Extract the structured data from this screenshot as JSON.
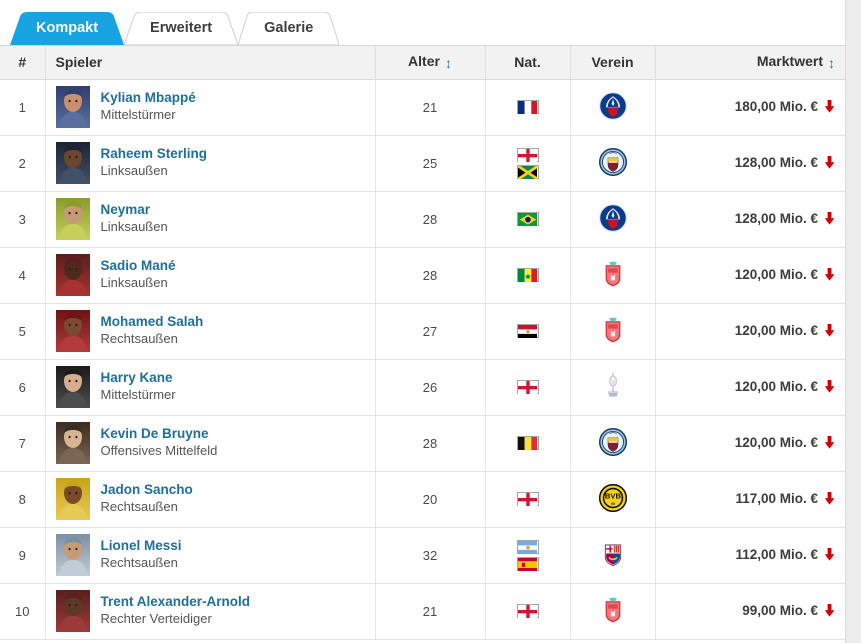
{
  "tabs": [
    {
      "label": "Kompakt",
      "active": true
    },
    {
      "label": "Erweitert",
      "active": false
    },
    {
      "label": "Galerie",
      "active": false
    }
  ],
  "colors": {
    "active_tab_bg": "#17a3e0",
    "link": "#1f6f9a",
    "header_bg": "#f2f2f2",
    "down_arrow": "#cc0000"
  },
  "table": {
    "columns": [
      {
        "key": "rank",
        "label": "#",
        "sortable": false
      },
      {
        "key": "player",
        "label": "Spieler",
        "sortable": false
      },
      {
        "key": "age",
        "label": "Alter",
        "sortable": true
      },
      {
        "key": "nat",
        "label": "Nat.",
        "sortable": false
      },
      {
        "key": "club",
        "label": "Verein",
        "sortable": false
      },
      {
        "key": "mv",
        "label": "Marktwert",
        "sortable": true
      }
    ],
    "sort_icon": "↕",
    "trend_icon": "down-arrow-icon",
    "rows": [
      {
        "rank": "1",
        "name": "Kylian Mbappé",
        "position": "Mittelstürmer",
        "age": "21",
        "nationalities": [
          "France"
        ],
        "club": "Paris Saint-Germain",
        "market_value": "180,00 Mio. €",
        "trend": "down"
      },
      {
        "rank": "2",
        "name": "Raheem Sterling",
        "position": "Linksaußen",
        "age": "25",
        "nationalities": [
          "England",
          "Jamaica"
        ],
        "club": "Manchester City",
        "market_value": "128,00 Mio. €",
        "trend": "down"
      },
      {
        "rank": "3",
        "name": "Neymar",
        "position": "Linksaußen",
        "age": "28",
        "nationalities": [
          "Brazil"
        ],
        "club": "Paris Saint-Germain",
        "market_value": "128,00 Mio. €",
        "trend": "down"
      },
      {
        "rank": "4",
        "name": "Sadio Mané",
        "position": "Linksaußen",
        "age": "28",
        "nationalities": [
          "Senegal"
        ],
        "club": "FC Liverpool",
        "market_value": "120,00 Mio. €",
        "trend": "down"
      },
      {
        "rank": "5",
        "name": "Mohamed Salah",
        "position": "Rechtsaußen",
        "age": "27",
        "nationalities": [
          "Egypt"
        ],
        "club": "FC Liverpool",
        "market_value": "120,00 Mio. €",
        "trend": "down"
      },
      {
        "rank": "6",
        "name": "Harry Kane",
        "position": "Mittelstürmer",
        "age": "26",
        "nationalities": [
          "England"
        ],
        "club": "Tottenham Hotspur",
        "market_value": "120,00 Mio. €",
        "trend": "down"
      },
      {
        "rank": "7",
        "name": "Kevin De Bruyne",
        "position": "Offensives Mittelfeld",
        "age": "28",
        "nationalities": [
          "Belgium"
        ],
        "club": "Manchester City",
        "market_value": "120,00 Mio. €",
        "trend": "down"
      },
      {
        "rank": "8",
        "name": "Jadon Sancho",
        "position": "Rechtsaußen",
        "age": "20",
        "nationalities": [
          "England"
        ],
        "club": "Borussia Dortmund",
        "market_value": "117,00 Mio. €",
        "trend": "down"
      },
      {
        "rank": "9",
        "name": "Lionel Messi",
        "position": "Rechtsaußen",
        "age": "32",
        "nationalities": [
          "Argentina",
          "Spain"
        ],
        "club": "FC Barcelona",
        "market_value": "112,00 Mio. €",
        "trend": "down"
      },
      {
        "rank": "10",
        "name": "Trent Alexander-Arnold",
        "position": "Rechter Verteidiger",
        "age": "21",
        "nationalities": [
          "England"
        ],
        "club": "FC Liverpool",
        "market_value": "99,00 Mio. €",
        "trend": "down"
      }
    ]
  }
}
